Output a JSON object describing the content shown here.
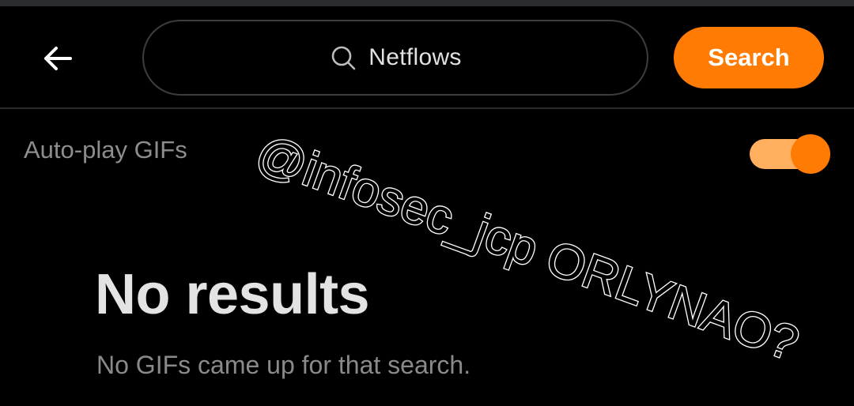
{
  "header": {
    "back_icon": "arrow-left-icon",
    "search": {
      "icon": "search-icon",
      "value": "Netflows"
    },
    "search_button_label": "Search"
  },
  "settings": {
    "autoplay_label": "Auto-play GIFs",
    "autoplay_enabled": true
  },
  "empty_state": {
    "title": "No results",
    "message": "No GIFs came up for that search."
  },
  "annotation": {
    "text": "@infosec_jcp ORLYNAO?"
  },
  "colors": {
    "accent": "#ff7b04",
    "toggle_track": "#ffaf5e",
    "background": "#000000"
  }
}
